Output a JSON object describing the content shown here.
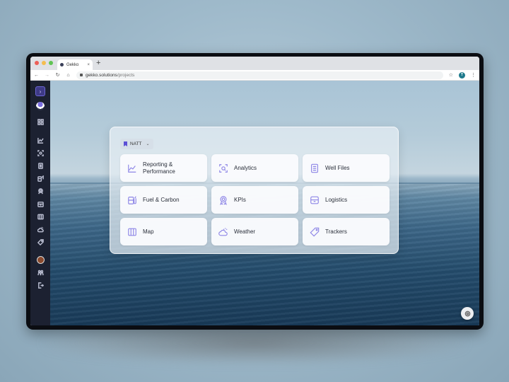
{
  "browser": {
    "tab_title": "Gekko",
    "tab_close": "×",
    "new_tab": "+",
    "url_host": "gekko.solutions",
    "url_path": "/projects",
    "profile_initial": "T",
    "nav": {
      "back": "←",
      "forward": "→",
      "reload": "↻",
      "home": "⌂",
      "star": "☆",
      "menu": "⋮"
    }
  },
  "sidebar": {
    "toggle_icon": "›",
    "items": [
      {
        "name": "dashboard-grid-icon"
      },
      {
        "name": "reporting-chart-icon"
      },
      {
        "name": "analytics-scan-icon"
      },
      {
        "name": "well-files-icon"
      },
      {
        "name": "fuel-carbon-icon"
      },
      {
        "name": "kpis-award-icon"
      },
      {
        "name": "logistics-box-icon"
      },
      {
        "name": "map-icon"
      },
      {
        "name": "weather-icon"
      },
      {
        "name": "trackers-tag-icon"
      }
    ],
    "bottom": [
      {
        "name": "user-avatar"
      },
      {
        "name": "team-users-icon"
      },
      {
        "name": "logout-icon"
      }
    ]
  },
  "project_selector": {
    "label": "NATT",
    "chevron": "⌄"
  },
  "modules": [
    {
      "label": "Reporting & Performance",
      "icon": "reporting-chart-icon"
    },
    {
      "label": "Analytics",
      "icon": "analytics-scan-icon"
    },
    {
      "label": "Well Files",
      "icon": "well-files-icon"
    },
    {
      "label": "Fuel & Carbon",
      "icon": "fuel-carbon-icon"
    },
    {
      "label": "KPIs",
      "icon": "kpis-award-icon"
    },
    {
      "label": "Logistics",
      "icon": "logistics-box-icon"
    },
    {
      "label": "Map",
      "icon": "map-icon"
    },
    {
      "label": "Weather",
      "icon": "weather-icon"
    },
    {
      "label": "Trackers",
      "icon": "trackers-tag-icon"
    }
  ],
  "colors": {
    "accent": "#5b4fd6",
    "icon_tint": "#8d85e6",
    "sidebar_bg": "#1c2131"
  }
}
